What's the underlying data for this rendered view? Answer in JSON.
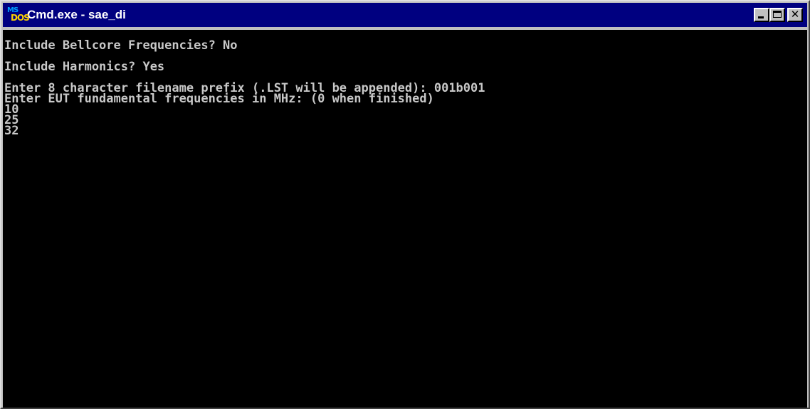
{
  "window": {
    "title": "Cmd.exe - sae_di",
    "icon": "ms-dos-icon",
    "icon_text_top": "MS",
    "icon_text_bottom": "DOS",
    "title_bar_color": "#000080",
    "console_background": "#000000",
    "console_text_color": "#c8c8c8"
  },
  "controls": {
    "minimize": "minimize-icon",
    "maximize": "maximize-icon",
    "close": "close-icon",
    "close_glyph": "✕"
  },
  "console": {
    "line1": "Include Bellcore Frequencies? No",
    "line2": "Include Harmonics? Yes",
    "line3": "Enter 8 character filename prefix (.LST will be appended): 001b001",
    "line4": "Enter EUT fundamental frequencies in MHz: (0 when finished)",
    "line5": "10",
    "line6": "25",
    "line7": "32"
  }
}
